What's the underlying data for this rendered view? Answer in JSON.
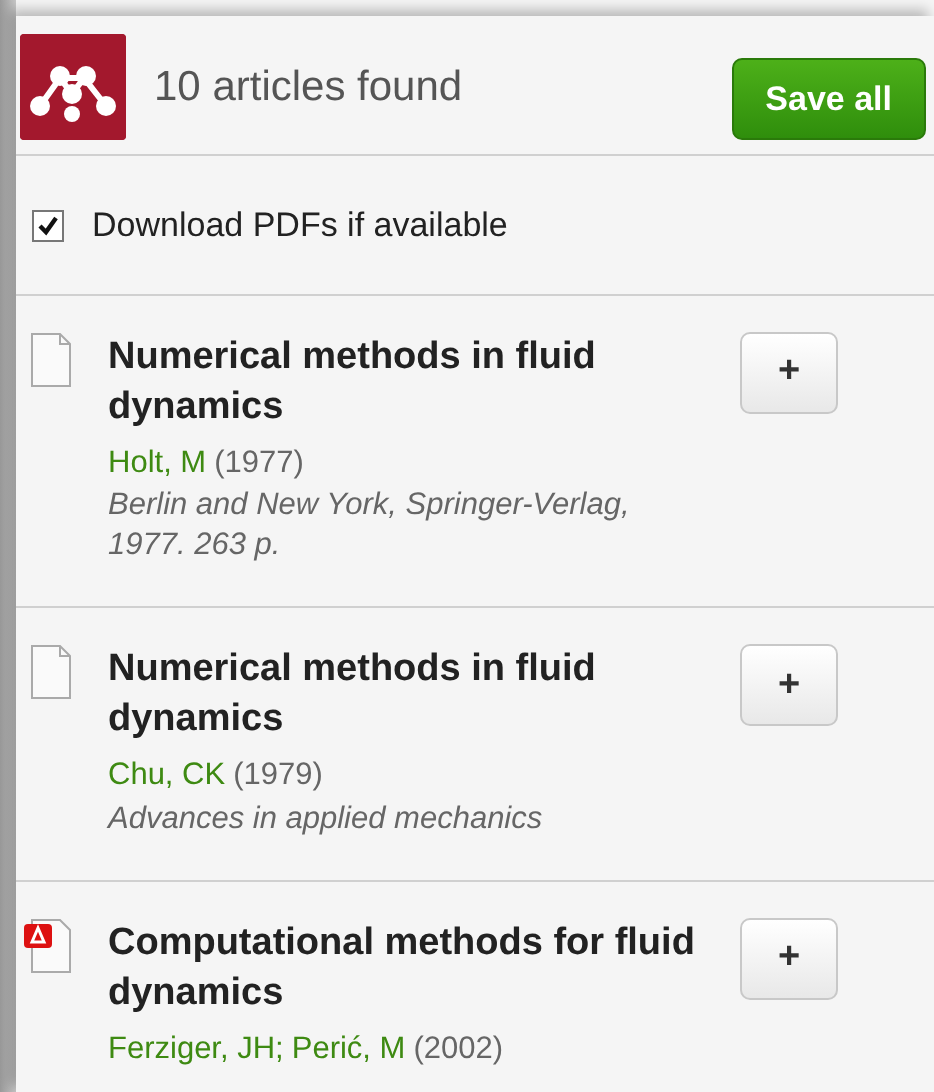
{
  "header": {
    "count_text": "10 articles found",
    "save_button": "Save all"
  },
  "download_option": {
    "label": "Download PDFs if available",
    "checked": true
  },
  "articles": [
    {
      "kind": "plain",
      "title": "Numerical methods in fluid dynamics",
      "authors": [
        "Holt, M"
      ],
      "year": "(1977)",
      "source": "Berlin and New York, Springer-Verlag, 1977. 263 p.",
      "add_button": "+"
    },
    {
      "kind": "plain",
      "title": "Numerical methods in fluid dynamics",
      "authors": [
        "Chu, CK"
      ],
      "year": "(1979)",
      "source": "Advances in applied mechanics",
      "add_button": "+"
    },
    {
      "kind": "pdf",
      "title": "Computational methods for fluid dynamics",
      "authors": [
        "Ferziger, JH;",
        "Perić, M"
      ],
      "year": "(2002)",
      "add_button": "+"
    }
  ]
}
